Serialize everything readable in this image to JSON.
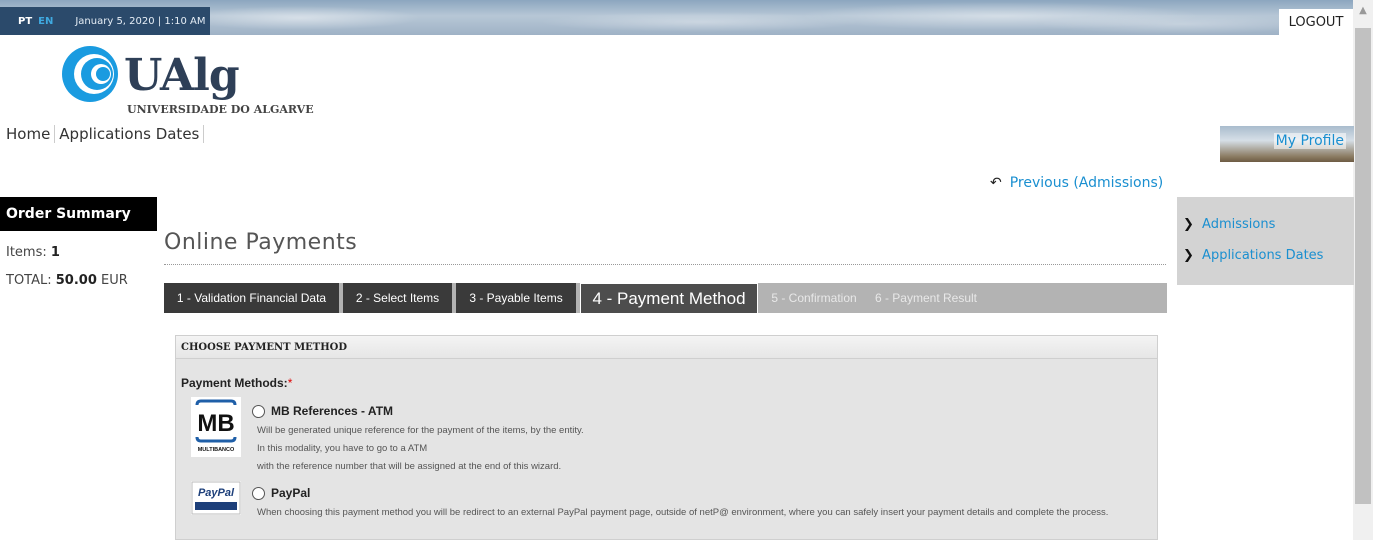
{
  "topbar": {
    "lang_pt": "PT",
    "lang_en": "EN",
    "datetime": "January 5, 2020 | 1:10 AM",
    "logout_label": "LOGOUT"
  },
  "logo": {
    "word": "UAlg",
    "subtitle": "UNIVERSIDADE DO ALGARVE"
  },
  "nav": {
    "items": [
      "Home",
      "Applications Dates"
    ]
  },
  "profile": {
    "label": "My Profile"
  },
  "previous_link": "Previous (Admissions)",
  "order_summary": {
    "title": "Order Summary",
    "items_label": "Items:",
    "items_value": "1",
    "total_label": "TOTAL:",
    "total_value": "50.00",
    "currency": "EUR"
  },
  "sidebar": {
    "items": [
      "Admissions",
      "Applications Dates"
    ]
  },
  "main": {
    "title": "Online Payments",
    "steps": [
      {
        "label": "1 - Validation Financial Data",
        "state": "done"
      },
      {
        "label": "2 - Select Items",
        "state": "done"
      },
      {
        "label": "3 - Payable Items",
        "state": "done"
      },
      {
        "label": "4 - Payment Method",
        "state": "active"
      },
      {
        "label": "5 - Confirmation",
        "state": "disabled"
      },
      {
        "label": "6 - Payment Result",
        "state": "disabled"
      }
    ]
  },
  "payment_panel": {
    "header": "CHOOSE PAYMENT METHOD",
    "methods_label": "Payment Methods:",
    "required_mark": "*",
    "options": [
      {
        "title": "MB References - ATM",
        "logo_text": "MB",
        "logo_sub": "MULTIBANCO",
        "description": [
          "Will be generated unique reference for the payment of the items, by the entity.",
          "In this modality, you have to go to a ATM",
          "with the reference number that will be assigned at the end of this wizard."
        ]
      },
      {
        "title": "PayPal",
        "logo_text": "PayPal",
        "description": [
          "When choosing this payment method you will be redirect to an external PayPal payment page, outside of netP@ environment, where you can safely insert your payment details and complete the process."
        ]
      }
    ]
  },
  "colors": {
    "accent_blue": "#1a8fd0",
    "active_step": "#4d4d4d",
    "done_step": "#3a3a3a"
  }
}
